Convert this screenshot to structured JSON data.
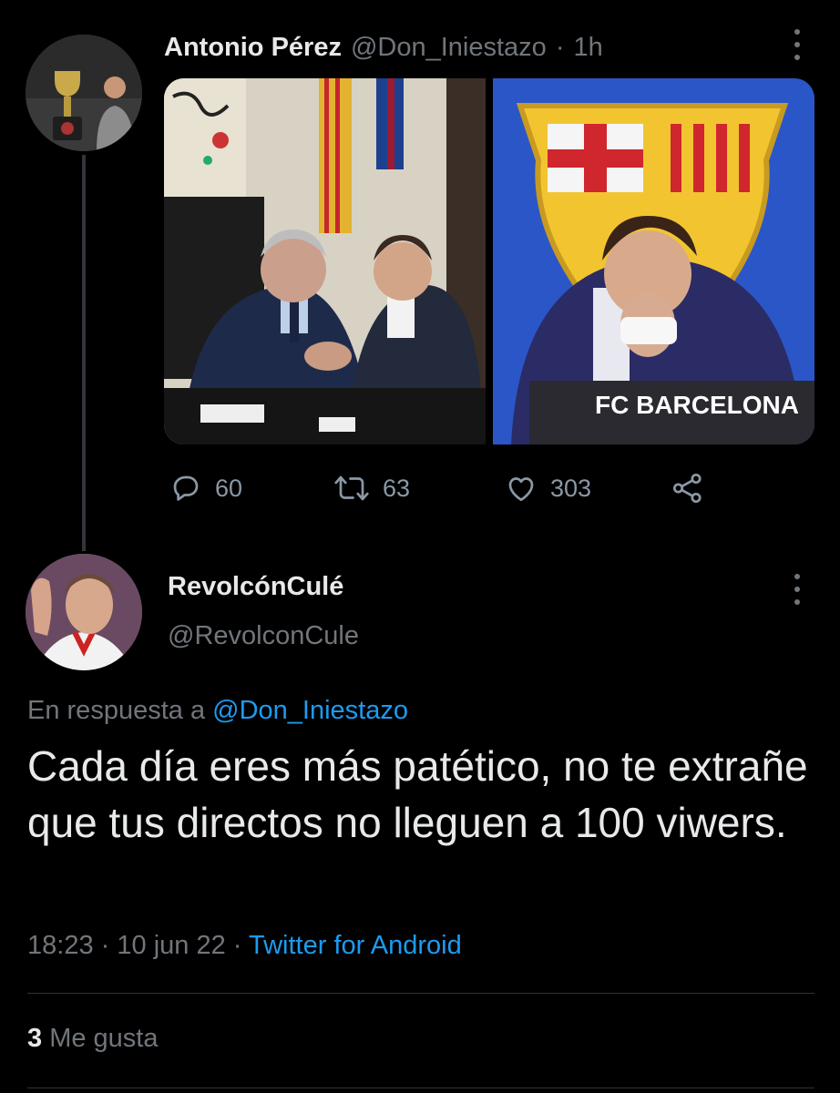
{
  "parent_tweet": {
    "author_name": "Antonio Pérez",
    "handle": "@Don_Iniestazo",
    "separator": "·",
    "time": "1h",
    "media": [
      {
        "overlay_text": ""
      },
      {
        "overlay_text": "FC BARCELONA"
      }
    ],
    "actions": {
      "replies": "60",
      "retweets": "63",
      "likes": "303"
    }
  },
  "reply_tweet": {
    "author_name": "RevolcónCulé",
    "handle": "@RevolconCule",
    "in_reply_prefix": "En respuesta a",
    "in_reply_mention": "@Don_Iniestazo",
    "text": "Cada día eres más patético, no te extrañe que tus directos no lleguen a 100 viwers.",
    "time": "18:23",
    "date": "10 jun 22",
    "separator": "·",
    "source": "Twitter for Android",
    "like_count": "3",
    "like_label": "Me gusta"
  },
  "colors": {
    "background": "#000000",
    "text_primary": "#e7e9ea",
    "text_secondary": "#71767b",
    "accent": "#1d9bf0",
    "divider": "#2f3336"
  }
}
